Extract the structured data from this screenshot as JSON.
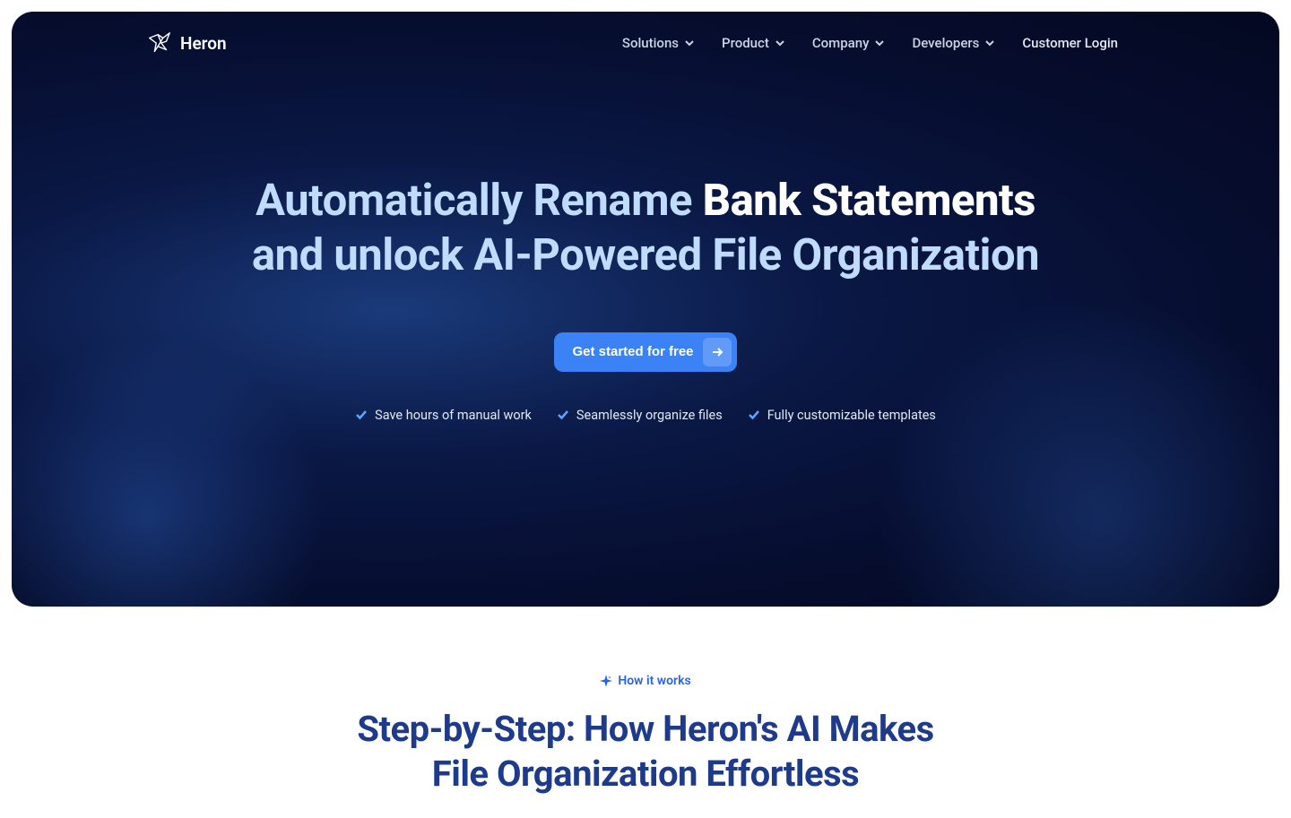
{
  "brand": {
    "name": "Heron"
  },
  "nav": {
    "items": [
      {
        "label": "Solutions",
        "hasDropdown": true
      },
      {
        "label": "Product",
        "hasDropdown": true
      },
      {
        "label": "Company",
        "hasDropdown": true
      },
      {
        "label": "Developers",
        "hasDropdown": true
      }
    ],
    "login": "Customer Login"
  },
  "hero": {
    "title_part1": "Automatically Rename ",
    "title_bold": "Bank Statements",
    "title_part2": " and unlock AI-Powered File Organization",
    "cta": "Get started for free",
    "features": [
      "Save hours of manual work",
      "Seamlessly organize files",
      "Fully customizable templates"
    ]
  },
  "section2": {
    "label": "How it works",
    "title": "Step-by-Step: How Heron's AI Makes File Organization Effortless"
  }
}
